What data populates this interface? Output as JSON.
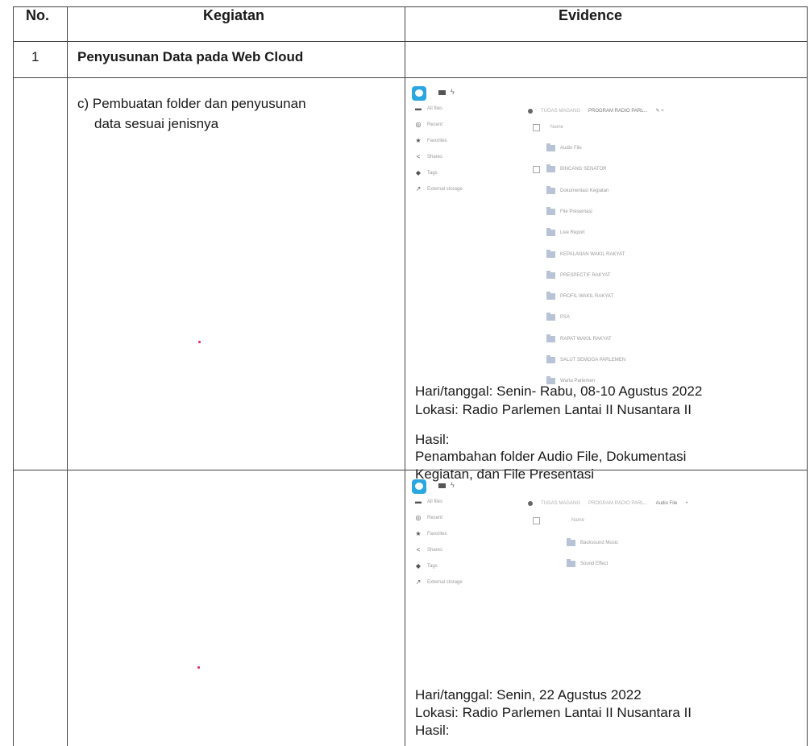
{
  "table": {
    "header": {
      "no": "No.",
      "kegiatan": "Kegiatan",
      "evidence": "Evidence"
    },
    "section": {
      "no": "1",
      "title": "Penyusunan Data pada Web Cloud"
    },
    "row_c": {
      "activity_line1": "c)  Pembuatan folder dan penyusunan",
      "activity_line2": "data sesuai jenisnya",
      "date": "Hari/tanggal: Senin- Rabu, 08-10 Agustus 2022",
      "location": "Lokasi: Radio Parlemen Lantai II Nusantara II",
      "result_label": "Hasil:",
      "result_line1": "Penambahan folder Audio File, Dokumentasi",
      "result_line2": "Kegiatan, dan File Presentasi"
    },
    "row_next": {
      "date": "Hari/tanggal: Senin, 22 Agustus 2022",
      "location": "Lokasi: Radio Parlemen Lantai II Nusantara II",
      "result_label": "Hasil:"
    }
  },
  "screenshot1": {
    "nav": [
      {
        "icon": "folder-icon",
        "label": "All files"
      },
      {
        "icon": "clock-icon",
        "label": "Recent"
      },
      {
        "icon": "star-icon",
        "label": "Favorites"
      },
      {
        "icon": "share-icon",
        "label": "Shares"
      },
      {
        "icon": "tag-icon",
        "label": "Tags"
      },
      {
        "icon": "external-storage-icon",
        "label": "External storage"
      }
    ],
    "breadcrumb": [
      "TUGAS MAGANG",
      "PROGRAM RADIO PARL..."
    ],
    "column_name": "Name",
    "folders": [
      "Audio File",
      "BINCANG SENATOR",
      "Dokumentasi Kegiatan",
      "File Presentasi",
      "Live Report",
      "KEPALANAN WAKIL RAKYAT",
      "PRESPECTIF RAKYAT",
      "PROFIL WAKIL RAKYAT",
      "PSA",
      "RAPAT WAKIL RAKYAT",
      "SALUT SEMOGA PARLEMEN",
      "Warta Parlemen"
    ]
  },
  "screenshot2": {
    "nav": [
      {
        "icon": "folder-icon",
        "label": "All files"
      },
      {
        "icon": "clock-icon",
        "label": "Recent"
      },
      {
        "icon": "star-icon",
        "label": "Favorites"
      },
      {
        "icon": "share-icon",
        "label": "Shares"
      },
      {
        "icon": "tag-icon",
        "label": "Tags"
      },
      {
        "icon": "external-storage-icon",
        "label": "External storage"
      }
    ],
    "breadcrumb": [
      "TUGAS MAGANG",
      "PROGRAM RADIO PARL...",
      "Audio File"
    ],
    "column_name": "Name",
    "folders": [
      "Backsound Music",
      "Sound Effect"
    ]
  }
}
